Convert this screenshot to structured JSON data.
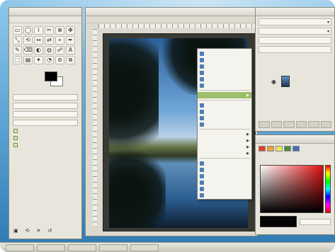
{
  "toolbox": {
    "tools": [
      "▭",
      "◯",
      "⌇",
      "✂",
      "⊕",
      "✥",
      "⤡",
      "⟲",
      "↔",
      "⇄",
      "⌖",
      "✒",
      "✎",
      "⌫",
      "◐",
      "◍",
      "☍",
      "A",
      "⬚",
      "▤",
      "✦",
      "◔",
      "⊘",
      "⧉"
    ]
  },
  "image_window": {
    "menus": [
      "",
      "",
      "",
      "",
      "",
      "",
      "",
      "",
      ""
    ]
  },
  "context_menu": {
    "items": [
      "",
      "",
      "",
      "",
      "",
      "",
      "",
      "",
      "",
      "",
      "",
      "",
      "",
      "",
      "",
      "",
      "",
      "",
      "",
      "",
      ""
    ]
  },
  "colors": {
    "accent_green": "#9bbf6a",
    "foreground": "#000000",
    "background": "#ffffff",
    "palette": [
      "#e23b2b",
      "#e9a23b",
      "#f2e35c",
      "#4a8f3b",
      "#3b6fb8"
    ]
  }
}
